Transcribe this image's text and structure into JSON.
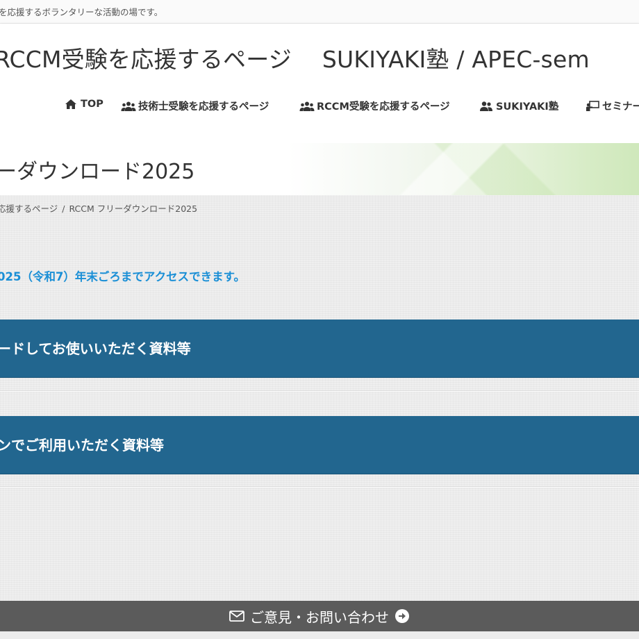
{
  "topbar": {
    "text": "を応援するボランタリーな活動の場です。"
  },
  "header": {
    "site_title": "RCCM受験を応援するページ　 SUKIYAKI塾 / APEC-sem",
    "nav": [
      {
        "label": "TOP",
        "icon": "home-icon"
      },
      {
        "label": "技術士受験を応援するページ",
        "icon": "users-icon"
      },
      {
        "label": "RCCM受験を応援するページ",
        "icon": "users-icon"
      },
      {
        "label": "SUKIYAKI塾",
        "icon": "user-group-icon"
      },
      {
        "label": "セミナー",
        "icon": "presentation-icon"
      }
    ]
  },
  "page": {
    "title": "ーダウンロード2025",
    "breadcrumb": {
      "parent": "応援するページ",
      "separator": "/",
      "current": "RCCM フリーダウンロード2025"
    },
    "notice": "025（令和7）年末ごろまでアクセスできます。",
    "sections": [
      {
        "label": "ードしてお使いいただく資料等"
      },
      {
        "label": "ンでご利用いただく資料等"
      }
    ]
  },
  "footer": {
    "contact_label": "ご意見・お問い合わせ",
    "mail_icon": "mail-icon",
    "arrow_icon": "arrow-circle-right-icon"
  },
  "colors": {
    "accent_blue": "#1a8fd6",
    "section_bar": "#22668f",
    "footer_bar": "#5b5b5b"
  }
}
